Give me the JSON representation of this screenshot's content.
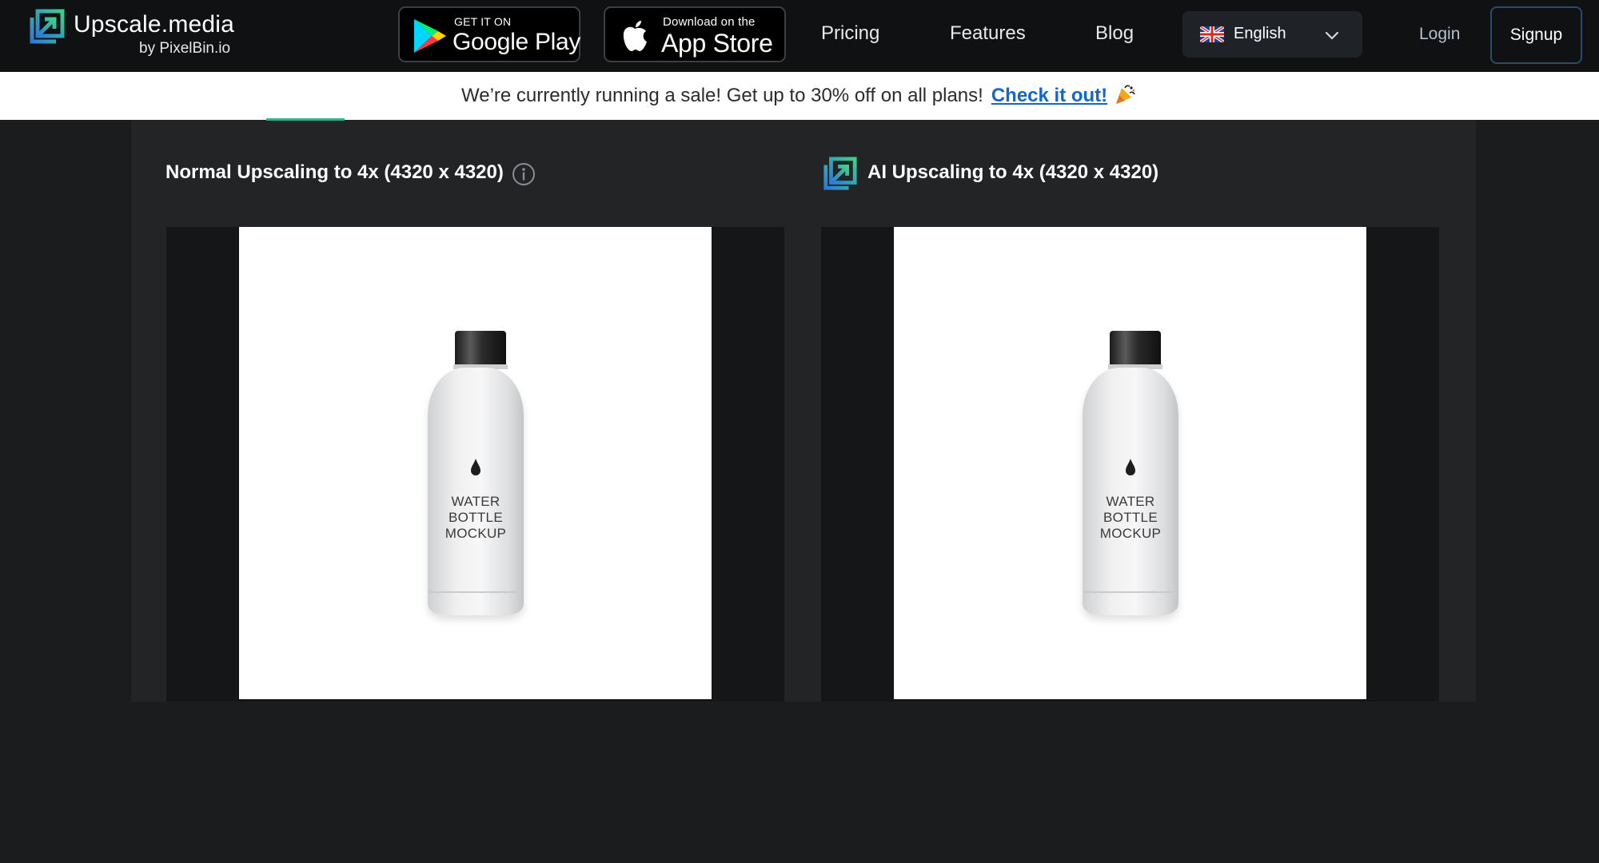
{
  "nav": {
    "logo": {
      "title": "Upscale.media",
      "subtitle": "by PixelBin.io",
      "icon": "upscale-logo-icon"
    },
    "google_play": {
      "small": "GET IT ON",
      "big": "Google Play",
      "icon": "google-play-icon"
    },
    "app_store": {
      "small": "Download on the",
      "big": "App Store",
      "icon": "apple-icon"
    },
    "links": {
      "pricing": "Pricing",
      "features": "Features",
      "blog": "Blog"
    },
    "language": {
      "label": "English",
      "flag_icon": "uk-flag-icon",
      "chevron_icon": "chevron-down-icon"
    },
    "login": "Login",
    "signup": "Signup"
  },
  "banner": {
    "text": "We’re currently running a sale! Get up to 30% off on all plans!",
    "link": "Check it out!",
    "icon": "party-popper-icon"
  },
  "comparison": {
    "left": {
      "title": "Normal Upscaling to 4x (4320 x 4320)",
      "icon": "info-icon",
      "image_text": [
        "WATER",
        "BOTTLE",
        "MOCKUP"
      ]
    },
    "right": {
      "title": "AI Upscaling to 4x (4320 x 4320)",
      "icon": "upscale-logo-icon",
      "image_text": [
        "WATER",
        "BOTTLE",
        "MOCKUP"
      ]
    }
  },
  "colors": {
    "nav_bg": "#0f1113",
    "page_bg": "#1b1c1e",
    "section_bg": "#232425",
    "panel_bg": "#151617",
    "accent_green": "#2fb38a",
    "link_blue": "#1466c8"
  }
}
